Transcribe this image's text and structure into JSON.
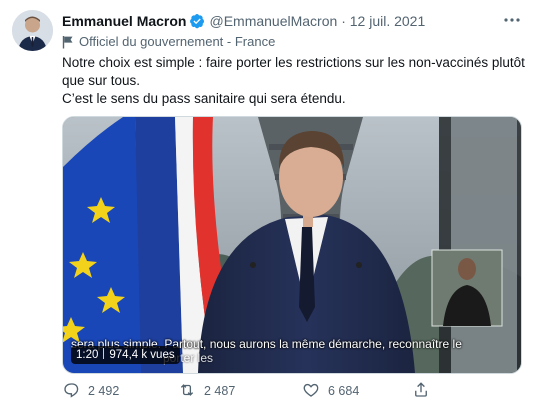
{
  "tweet": {
    "author_name": "Emmanuel Macron",
    "handle": "@EmmanuelMacron",
    "separator": "·",
    "date": "12 juil. 2021",
    "label": "Officiel du gouvernement - France",
    "text_lines": [
      "Notre choix est simple : faire porter les restrictions sur les non-vaccinés plutôt",
      "que sur tous.",
      "C’est le sens du pass sanitaire qui sera étendu."
    ]
  },
  "video": {
    "subtitle_line1": "sera plus simple. Partout, nous aurons la même démarche, reconnaître le",
    "subtitle_line2": "porter les",
    "duration": "1:20",
    "views": "974,4 k vues"
  },
  "actions": {
    "reply_count": "2 492",
    "retweet_count": "2 487",
    "like_count": "6 684"
  },
  "icons": {
    "verified": "verified-badge-icon",
    "more": "more-icon",
    "government": "flag-icon",
    "reply": "reply-icon",
    "retweet": "retweet-icon",
    "like": "like-icon",
    "share": "share-icon"
  },
  "colors": {
    "verified_blue": "#1d9bf0",
    "secondary_text": "#536471",
    "eu_blue": "#1a47b8",
    "eu_star": "#f2d21b",
    "fr_red": "#e1322d"
  }
}
